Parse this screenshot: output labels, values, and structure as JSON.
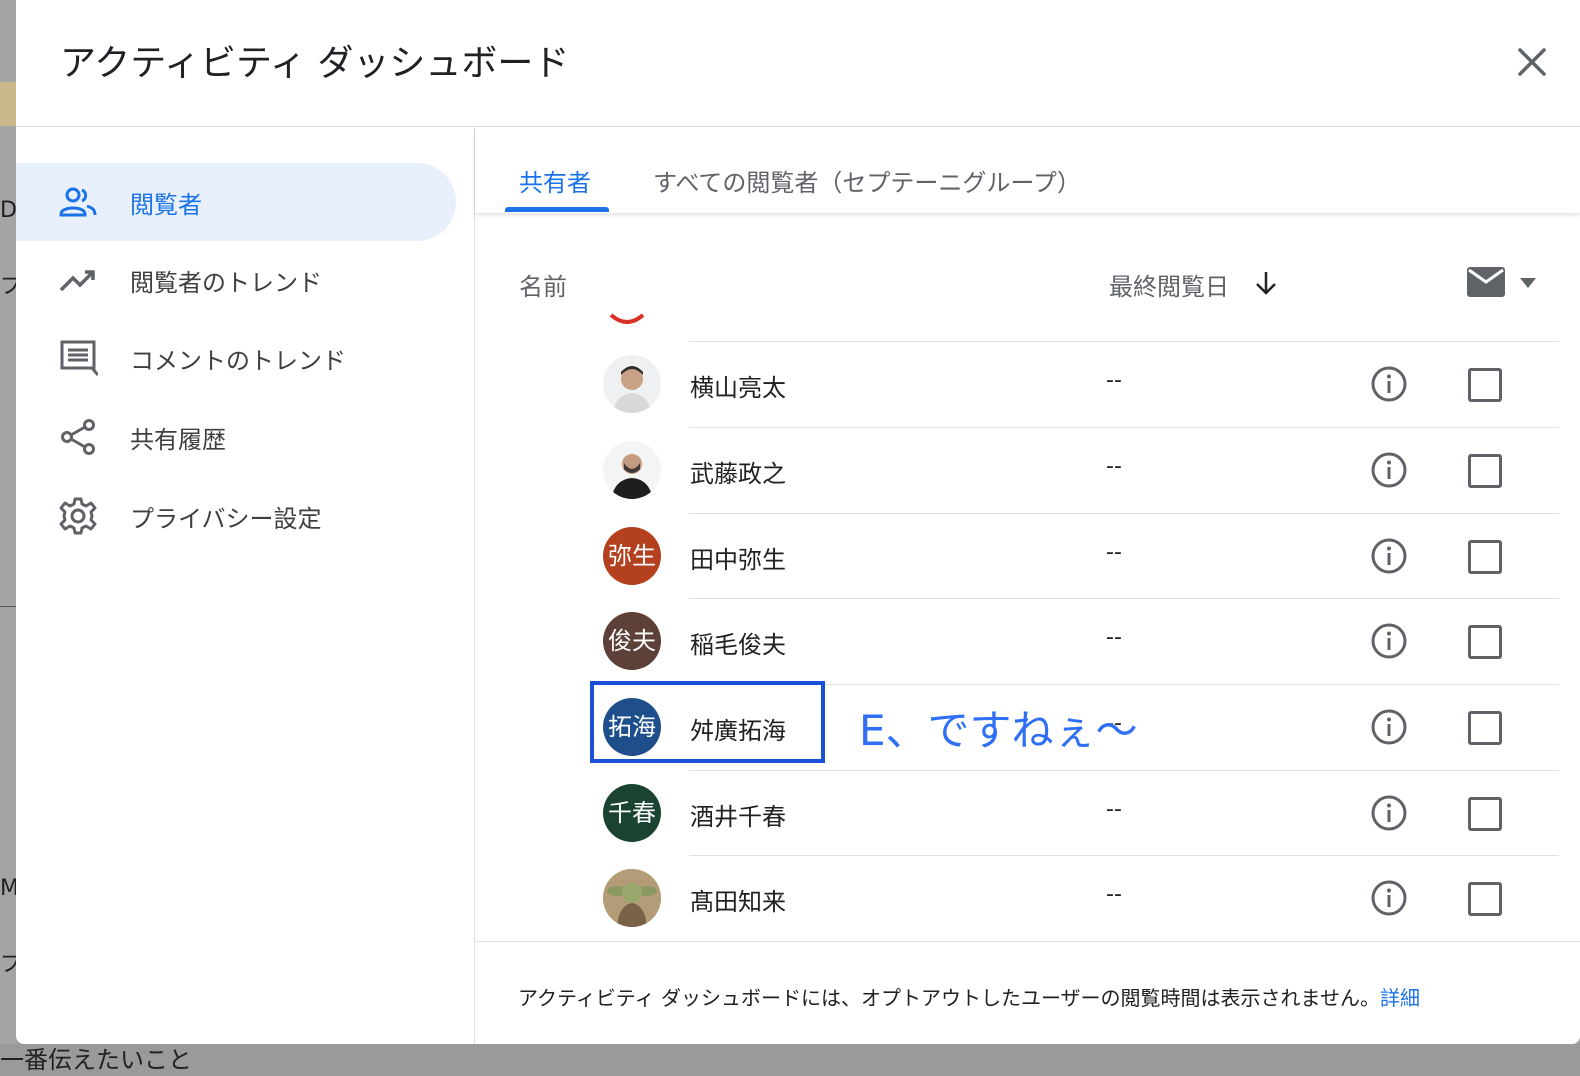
{
  "background": {
    "fragments": [
      "Di",
      "プ",
      "M",
      "プ"
    ],
    "bottom_text": "一番伝えたいこと"
  },
  "dialog": {
    "title": "アクティビティ ダッシュボード",
    "close_icon": "close-icon"
  },
  "sidebar": {
    "items": [
      {
        "label": "閲覧者",
        "icon": "people-icon",
        "active": true
      },
      {
        "label": "閲覧者のトレンド",
        "icon": "trending-up-icon",
        "active": false
      },
      {
        "label": "コメントのトレンド",
        "icon": "comment-icon",
        "active": false
      },
      {
        "label": "共有履歴",
        "icon": "share-icon",
        "active": false
      },
      {
        "label": "プライバシー設定",
        "icon": "gear-icon",
        "active": false
      }
    ]
  },
  "tabs": [
    {
      "label": "共有者",
      "active": true
    },
    {
      "label": "すべての閲覧者（セプテーニグループ）",
      "active": false
    }
  ],
  "table": {
    "col_name": "名前",
    "col_date": "最終閲覧日",
    "sort": "descending",
    "rows": [
      {
        "name": "横山亮太",
        "avatar_text": "",
        "avatar_type": "photo",
        "last_viewed": "--"
      },
      {
        "name": "武藤政之",
        "avatar_text": "",
        "avatar_type": "photo",
        "last_viewed": "--"
      },
      {
        "name": "田中弥生",
        "avatar_text": "弥生",
        "avatar_color": "#b3401f",
        "last_viewed": "--"
      },
      {
        "name": "稲毛俊夫",
        "avatar_text": "俊夫",
        "avatar_color": "#5d4037",
        "last_viewed": "--"
      },
      {
        "name": "舛廣拓海",
        "avatar_text": "拓海",
        "avatar_color": "#1e4f8c",
        "last_viewed": "--"
      },
      {
        "name": "酒井千春",
        "avatar_text": "千春",
        "avatar_color": "#1b4332",
        "last_viewed": "--"
      },
      {
        "name": "髙田知来",
        "avatar_text": "",
        "avatar_type": "photo",
        "last_viewed": "--"
      }
    ]
  },
  "annotation": {
    "text": "E、ですねぇ〜",
    "color": "#2e6ff5"
  },
  "footer": {
    "text": "アクティビティ ダッシュボードには、オプトアウトしたユーザーの閲覧時間は表示されません。",
    "link": "詳細"
  }
}
